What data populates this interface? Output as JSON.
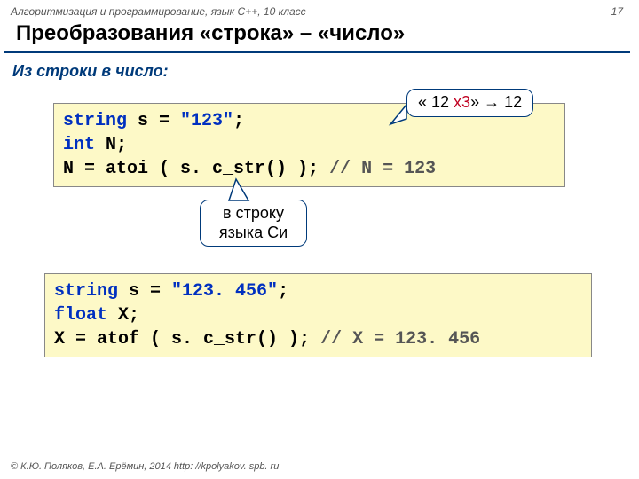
{
  "header": {
    "left": "Алгоритмизация и программирование, язык C++, 10 класс",
    "pageNum": "17"
  },
  "title": "Преобразования «строка» – «число»",
  "subtitle": "Из строки в число:",
  "code1": {
    "l1a": "string",
    "l1b": " s = ",
    "l1c": "\"123\"",
    "l1d": ";",
    "l2a": "int",
    "l2b": " N;",
    "l3a": "N = atoi ( s. c_str() );   ",
    "l3b": "// N = 123"
  },
  "callout1": {
    "pre": "« 12 ",
    "mid": "x3",
    "post": "» → 12"
  },
  "callout2": {
    "l1": "в строку",
    "l2": "языка Си"
  },
  "code2": {
    "l1a": "string",
    "l1b": " s = ",
    "l1c": "\"123. 456\"",
    "l1d": ";",
    "l2a": "float",
    "l2b": " X;",
    "l3a": "X = atof ( s. c_str() ); ",
    "l3b": "// X = 123. 456"
  },
  "footer": "© К.Ю. Поляков, Е.А. Ерёмин, 2014  http: //kpolyakov. spb. ru"
}
